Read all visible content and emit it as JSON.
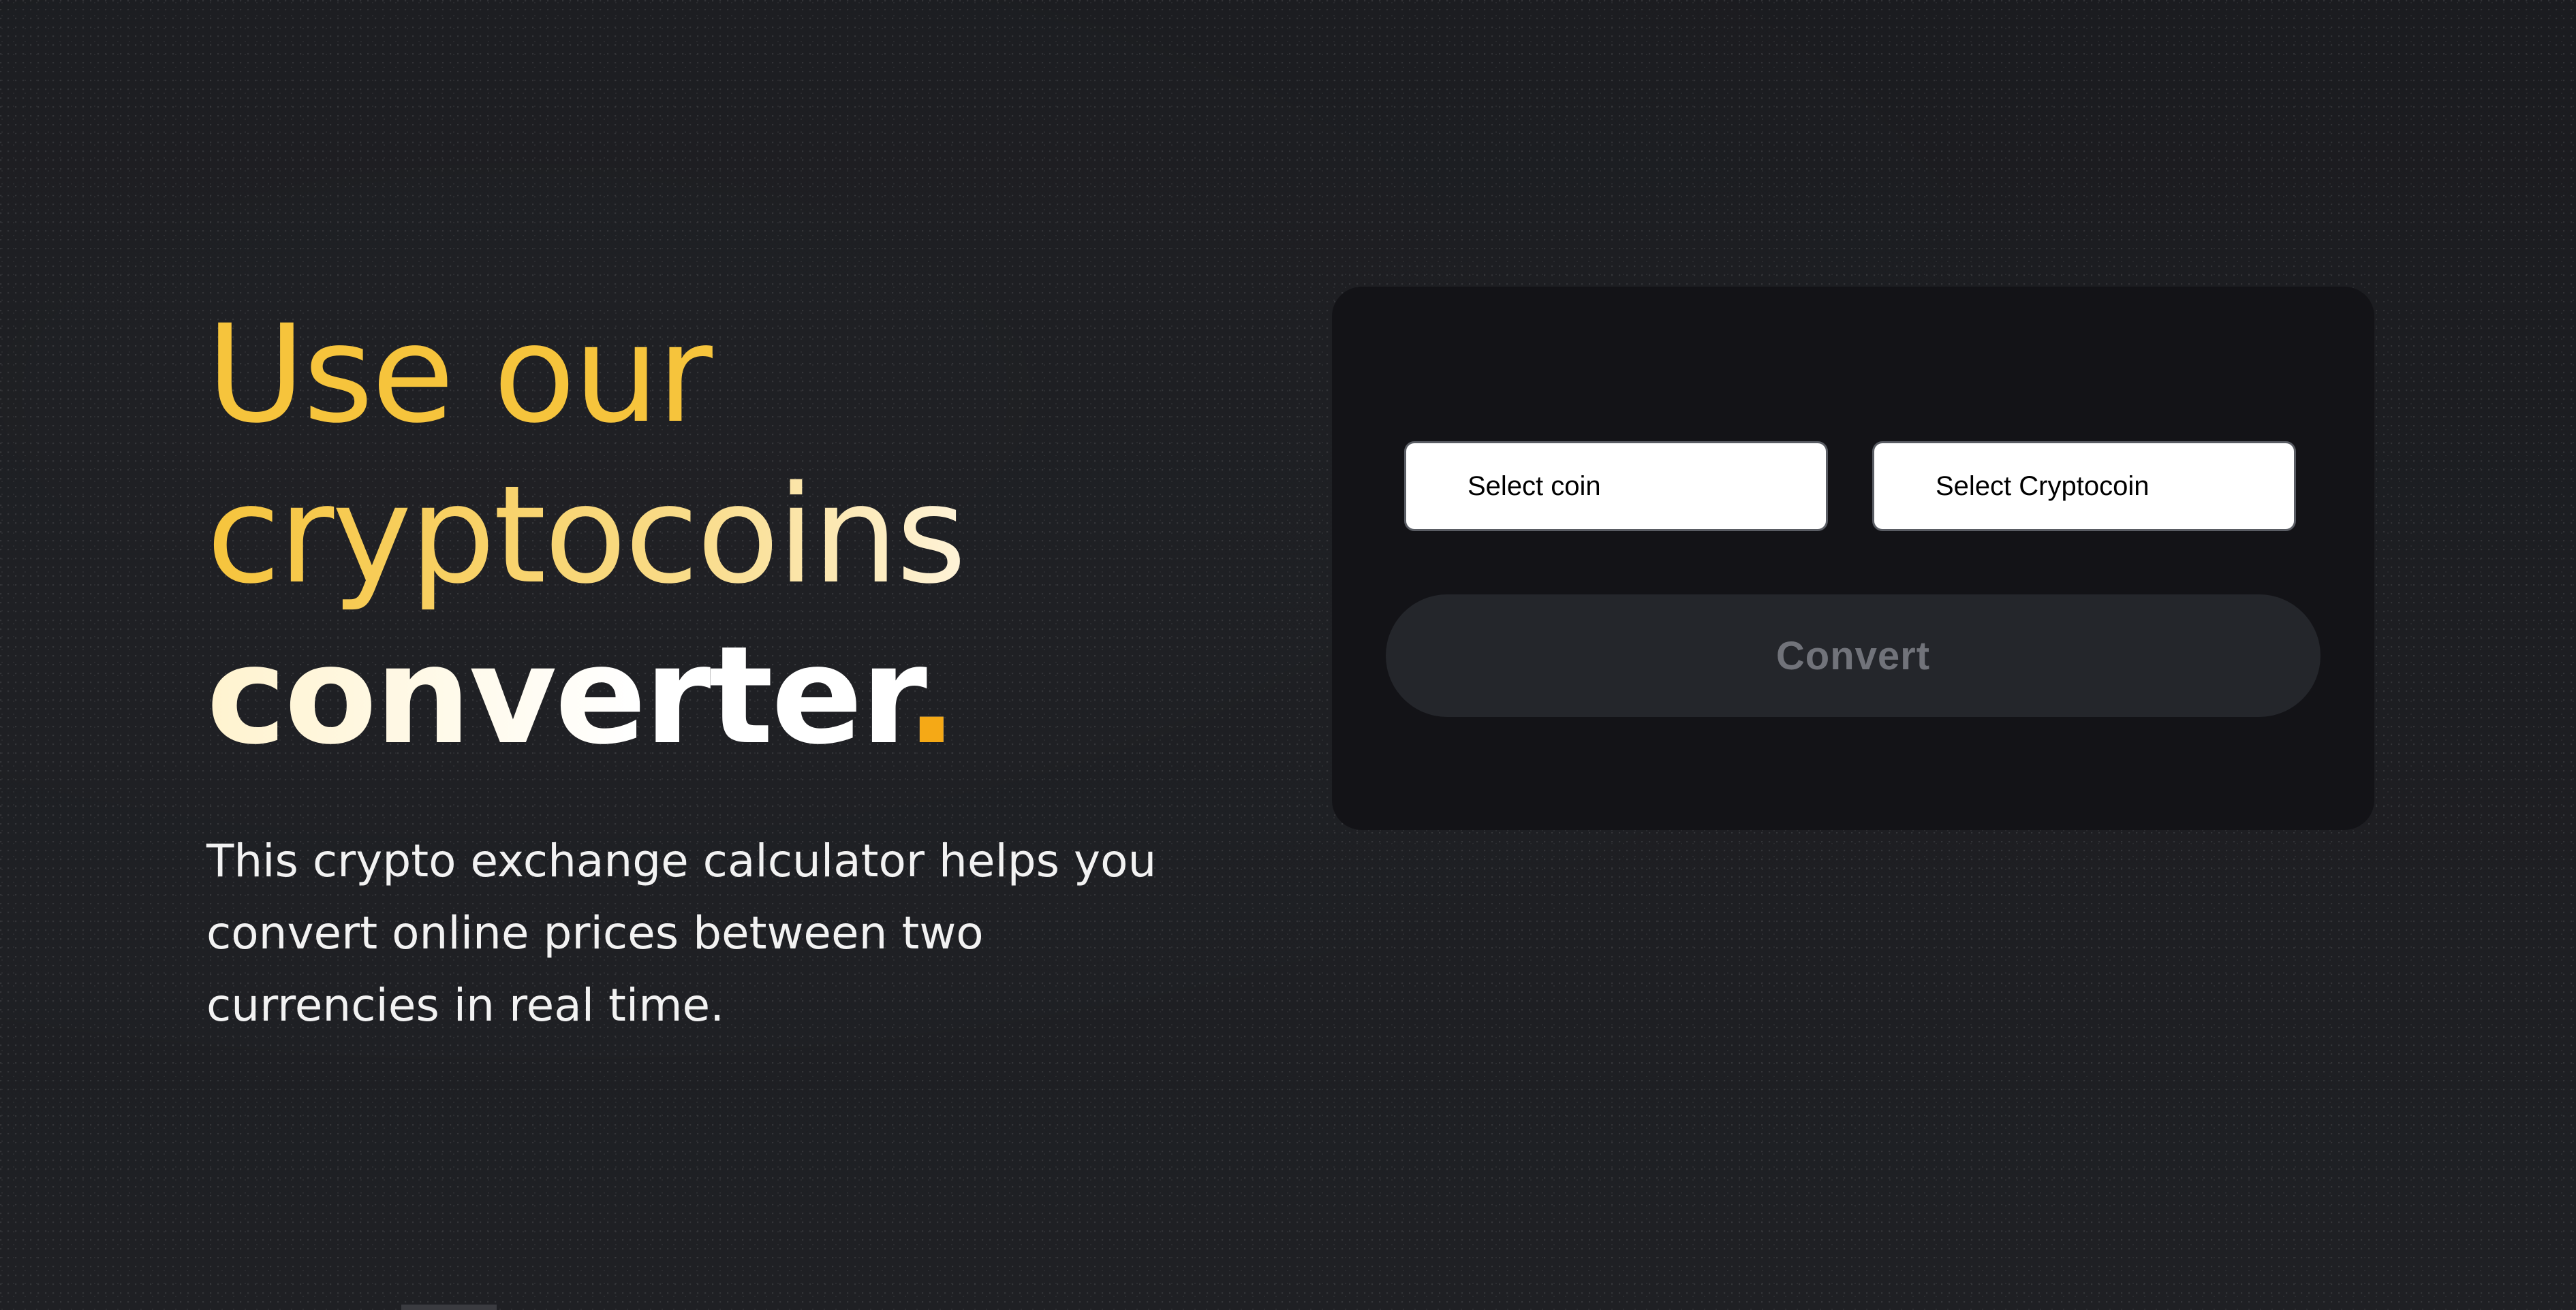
{
  "hero": {
    "headline_line1": "Use our",
    "headline_line2": "cryptocoins",
    "headline_line3": "converter",
    "headline_dot": ".",
    "description": "This crypto exchange calculator helps you convert online prices between two currencies in real time."
  },
  "converter": {
    "from_select": {
      "placeholder": "Select coin"
    },
    "to_select": {
      "placeholder": "Select Cryptocoin"
    },
    "convert_label": "Convert"
  },
  "colors": {
    "background": "#1c1d21",
    "card": "#131317",
    "accent": "#f6c43c",
    "accent_dot": "#f5a916",
    "button": "#24262b",
    "button_text": "#71737a"
  }
}
